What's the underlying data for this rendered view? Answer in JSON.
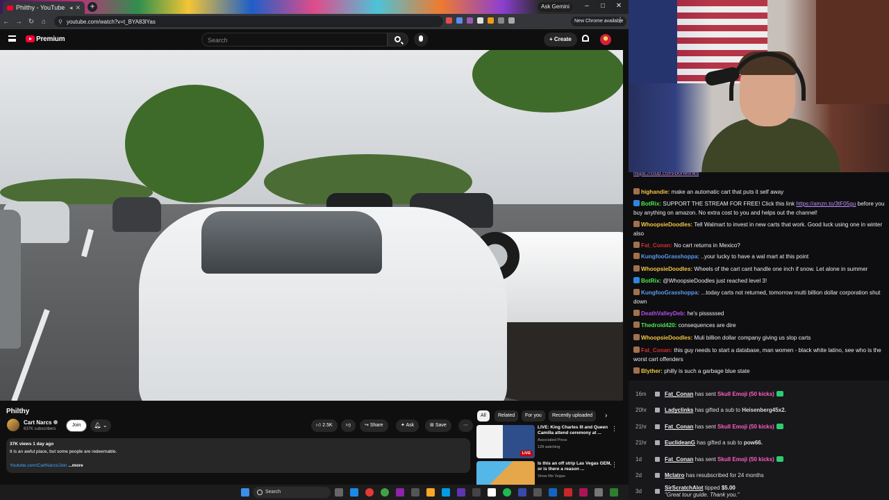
{
  "browser": {
    "tab_title": "Philthy - YouTube",
    "url": "youtube.com/watch?v=t_BYA83lYas",
    "ask_gemini": "Ask Gemini",
    "new_chrome": "New Chrome available"
  },
  "youtube": {
    "brand": "Premium",
    "search_placeholder": "Search",
    "create_label": "Create",
    "video": {
      "title": "Philthy",
      "channel": "Cart Narcs",
      "subscribers": "637K subscribers",
      "join_label": "Join",
      "likes": "2.5K",
      "share_label": "Share",
      "ask_label": "Ask",
      "save_label": "Save",
      "views_date": "37K views  1 day ago",
      "description": "It is an awful place, but some people are redeemable.",
      "link": "Youtube.com/CartNarcs/Join",
      "more": "...more"
    },
    "chips": [
      "All",
      "Related",
      "For you",
      "Recently uploaded"
    ],
    "related": [
      {
        "title": "LIVE: King Charles III and Queen Camilla attend ceremony at ...",
        "channel": "Associated Press",
        "meta": "128 watching",
        "badge": "LIVE"
      },
      {
        "title": "Is this an off strip Las Vegas GEM, or is there a reason ...",
        "channel": "Show Me Vegas",
        "meta": "",
        "badge": ""
      }
    ]
  },
  "chat": {
    "partial_link": "https://club.com/bohelinks",
    "messages": [
      {
        "user": "highandie",
        "color": "#f4c542",
        "text": "make an automatic cart that puts it self away"
      },
      {
        "user": "BotRix",
        "color": "#4de94c",
        "text": "SUPPORT THE STREAM FOR FREE! Click this link ",
        "link": "https://amzn.to/3tF05gu",
        "text2": " before you buy anything on amazon. No extra cost to you and helps out the channel!"
      },
      {
        "user": "WhoopsieDoodles",
        "color": "#f4c542",
        "text": "Tell Walmart to invest in new carts that work. Good luck using one in winter also"
      },
      {
        "user": "Fat_Conan",
        "color": "#d0312d",
        "text": "No cart returns in Mexico?"
      },
      {
        "user": "KungfooGrasshoppa",
        "color": "#5c9bf0",
        "text": "..your lucky to have a wal mart at this point"
      },
      {
        "user": "WhoopsieDoodles",
        "color": "#f4c542",
        "text": "Wheels of the cart cant handle one inch if snow. Let alone in summer"
      },
      {
        "user": "BotRix",
        "color": "#4de94c",
        "text": "@WhoopsieDoodles just reached level 3!"
      },
      {
        "user": "KungfooGrasshoppa",
        "color": "#5c9bf0",
        "text": "...today carts not returned, tomorrow multi billion dollar corporation shut down"
      },
      {
        "user": "DeathValleyDeb",
        "color": "#b44ee8",
        "text": "he's pisssssed"
      },
      {
        "user": "Thedroid420",
        "color": "#4de94c",
        "text": "consequences are dire"
      },
      {
        "user": "WhoopsieDoodles",
        "color": "#f4c542",
        "text": "Muli billion dollar company giving us slop carts"
      },
      {
        "user": "Fat_Conan",
        "color": "#d0312d",
        "text": "this guy needs to start a database, man women - black white latino, see who is the worst cart offenders"
      },
      {
        "user": "Blyther",
        "color": "#f4c542",
        "text": "philly is such a garbage blue state"
      }
    ]
  },
  "events": [
    {
      "age": "16m",
      "name": "Fat_Conan",
      "action": "has sent",
      "highlight": "Skull Emoji (50 kicks)",
      "suffix": "",
      "bits": true
    },
    {
      "age": "20hr",
      "name": "Ladyclinks",
      "action": "has gifted a sub to",
      "highlight": "",
      "suffix": "Heisenberg45x2.",
      "bits": false
    },
    {
      "age": "21hr",
      "name": "Fat_Conan",
      "action": "has sent",
      "highlight": "Skull Emoji (50 kicks)",
      "suffix": "",
      "bits": true
    },
    {
      "age": "21hr",
      "name": "EuclideanG",
      "action": "has gifted a sub to",
      "highlight": "",
      "suffix": "pow66.",
      "bits": false
    },
    {
      "age": "1d",
      "name": "Fat_Conan",
      "action": "has sent",
      "highlight": "Skull Emoji (50 kicks)",
      "suffix": "",
      "bits": true
    },
    {
      "age": "2d",
      "name": "Mclatro",
      "action": "has resubscribed for 24 months",
      "highlight": "",
      "suffix": "",
      "bits": false
    },
    {
      "age": "3d",
      "name": "SirScratchAlot",
      "action": "tipped",
      "highlight": "$5.00",
      "suffix": "",
      "bits": false,
      "quote": "\"Great tour guide. Thank you.\""
    }
  ],
  "taskbar": {
    "search_label": "Search"
  }
}
